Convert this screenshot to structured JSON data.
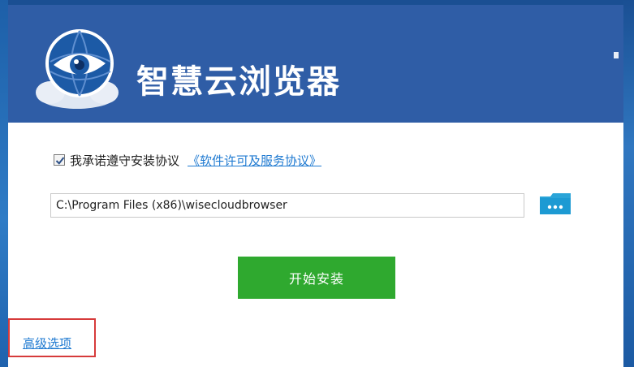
{
  "app": {
    "title": "智慧云浏览器"
  },
  "install": {
    "agree_label": "我承诺遵守安装协议",
    "agree_checked": true,
    "license_link": "《软件许可及服务协议》",
    "path_value": "C:\\Program Files (x86)\\wisecloudbrowser",
    "start_button": "开始安装",
    "advanced_link": "高级选项"
  },
  "icons": {
    "logo": "eye-cloud-logo-icon",
    "folder": "folder-icon",
    "check": "check-icon"
  },
  "colors": {
    "header": "#2f5da6",
    "install_button": "#2fa92f",
    "link": "#1f7ad1",
    "highlight_box": "#d63b3b"
  }
}
